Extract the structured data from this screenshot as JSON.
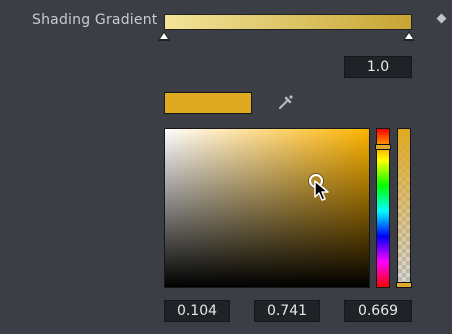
{
  "shading_gradient": {
    "label": "Shading Gradient",
    "start_color": "#f3e49a",
    "end_color": "#c7a534",
    "position_value": "1.0"
  },
  "color": {
    "swatch_color": "#e0a922",
    "hue_color": "#ffb400",
    "hue_level": 0.104,
    "alpha_level": 1.0
  },
  "components": {
    "h": "0.104",
    "s": "0.741",
    "v": "0.669"
  },
  "icons": [
    "keyframe-diamond-icon",
    "eyedropper-icon",
    "mouse-pointer-icon"
  ]
}
